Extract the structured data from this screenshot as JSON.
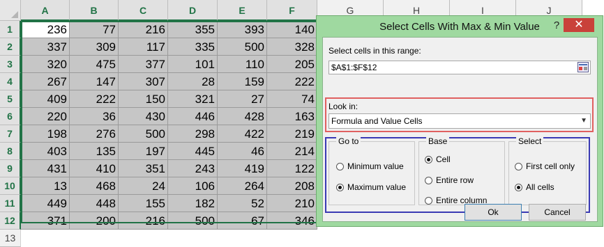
{
  "sheet": {
    "columns": [
      "A",
      "B",
      "C",
      "D",
      "E",
      "F"
    ],
    "far_columns": [
      "G",
      "H",
      "I",
      "J"
    ],
    "row_numbers": [
      "1",
      "2",
      "3",
      "4",
      "5",
      "6",
      "7",
      "8",
      "9",
      "10",
      "11",
      "12"
    ],
    "extra_row": "13",
    "rows": [
      [
        "236",
        "77",
        "216",
        "355",
        "393",
        "140"
      ],
      [
        "337",
        "309",
        "117",
        "335",
        "500",
        "328"
      ],
      [
        "320",
        "475",
        "377",
        "101",
        "110",
        "205"
      ],
      [
        "267",
        "147",
        "307",
        "28",
        "159",
        "222"
      ],
      [
        "409",
        "222",
        "150",
        "321",
        "27",
        "74"
      ],
      [
        "220",
        "36",
        "430",
        "446",
        "428",
        "163"
      ],
      [
        "198",
        "276",
        "500",
        "298",
        "422",
        "219"
      ],
      [
        "403",
        "135",
        "197",
        "445",
        "46",
        "214"
      ],
      [
        "431",
        "410",
        "351",
        "243",
        "419",
        "122"
      ],
      [
        "13",
        "468",
        "24",
        "106",
        "264",
        "208"
      ],
      [
        "449",
        "448",
        "155",
        "182",
        "52",
        "210"
      ],
      [
        "371",
        "200",
        "216",
        "500",
        "67",
        "346"
      ]
    ]
  },
  "dialog": {
    "title": "Select Cells With Max & Min Value",
    "help": "?",
    "close": "✕",
    "range_label": "Select cells in this range:",
    "range_value": "$A$1:$F$12",
    "lookin_label": "Look in:",
    "lookin_value": "Formula and Value Cells",
    "goto": {
      "title": "Go to",
      "min": "Minimum value",
      "max": "Maximum value"
    },
    "base": {
      "title": "Base",
      "cell": "Cell",
      "row": "Entire row",
      "column": "Entire column"
    },
    "select": {
      "title": "Select",
      "first": "First cell only",
      "all": "All cells"
    },
    "ok": "Ok",
    "cancel": "Cancel"
  },
  "colors": {
    "accent": "#217346",
    "dialog_frame": "#9fd9a0",
    "close": "#c9413a",
    "lookin_border": "#e06060",
    "options_border": "#3a3ab4"
  }
}
